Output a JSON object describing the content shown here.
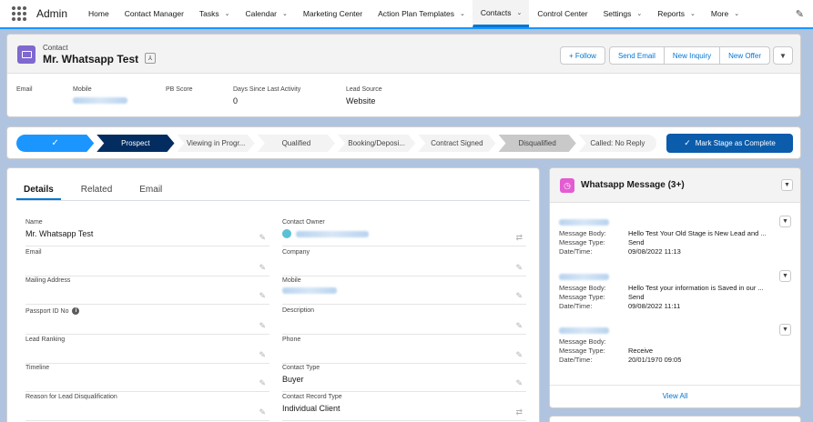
{
  "app": {
    "name": "Admin"
  },
  "nav": {
    "items": [
      {
        "label": "Home",
        "chevron": false
      },
      {
        "label": "Contact Manager",
        "chevron": false
      },
      {
        "label": "Tasks",
        "chevron": true
      },
      {
        "label": "Calendar",
        "chevron": true
      },
      {
        "label": "Marketing Center",
        "chevron": false
      },
      {
        "label": "Action Plan Templates",
        "chevron": true
      },
      {
        "label": "Contacts",
        "chevron": true,
        "active": true
      },
      {
        "label": "Control Center",
        "chevron": false
      },
      {
        "label": "Settings",
        "chevron": true
      },
      {
        "label": "Reports",
        "chevron": true
      },
      {
        "label": "More",
        "chevron": true
      }
    ]
  },
  "record": {
    "object_label": "Contact",
    "name": "Mr. Whatsapp Test",
    "actions": {
      "follow": "+ Follow",
      "send_email": "Send Email",
      "new_inquiry": "New Inquiry",
      "new_offer": "New Offer"
    },
    "highlights": {
      "email_label": "Email",
      "mobile_label": "Mobile",
      "pb_score_label": "PB Score",
      "days_label": "Days Since Last Activity",
      "days_value": "0",
      "lead_source_label": "Lead Source",
      "lead_source_value": "Website"
    }
  },
  "path": {
    "steps": [
      {
        "label": "✓",
        "state": "complete"
      },
      {
        "label": "Prospect",
        "state": "current"
      },
      {
        "label": "Viewing in Progr...",
        "state": "incomplete"
      },
      {
        "label": "Qualified",
        "state": "incomplete"
      },
      {
        "label": "Booking/Deposi...",
        "state": "incomplete"
      },
      {
        "label": "Contract Signed",
        "state": "incomplete"
      },
      {
        "label": "Disqualified",
        "state": "lost"
      },
      {
        "label": "Called: No Reply",
        "state": "incomplete"
      }
    ],
    "mark_complete": "Mark Stage as Complete"
  },
  "details": {
    "tabs": [
      "Details",
      "Related",
      "Email"
    ],
    "left": [
      {
        "label": "Name",
        "value": "Mr. Whatsapp Test"
      },
      {
        "label": "Email",
        "value": ""
      },
      {
        "label": "Mailing Address",
        "value": ""
      },
      {
        "label": "Passport ID No",
        "value": ""
      },
      {
        "label": "Lead Ranking",
        "value": ""
      },
      {
        "label": "Timeline",
        "value": ""
      },
      {
        "label": "Reason for Lead Disqualification",
        "value": ""
      }
    ],
    "right": [
      {
        "label": "Contact Owner",
        "value": ""
      },
      {
        "label": "Company",
        "value": ""
      },
      {
        "label": "Mobile",
        "value": ""
      },
      {
        "label": "Description",
        "value": ""
      },
      {
        "label": "Phone",
        "value": ""
      },
      {
        "label": "Contact Type",
        "value": "Buyer"
      },
      {
        "label": "Contact Record Type",
        "value": "Individual Client"
      }
    ]
  },
  "whatsapp": {
    "title": "Whatsapp Message (3+)",
    "labels": {
      "body": "Message Body:",
      "type": "Message Type:",
      "datetime": "Date/Time:"
    },
    "messages": [
      {
        "body": "Hello Test Your Old Stage is New Lead and ...",
        "type": "Send",
        "datetime": "09/08/2022 11:13"
      },
      {
        "body": "Hello Test your information is Saved in our ...",
        "type": "Send",
        "datetime": "09/08/2022 11:11"
      },
      {
        "body": "",
        "type": "Receive",
        "datetime": "20/01/1970 09:05"
      }
    ],
    "view_all": "View All"
  },
  "colors": {
    "brand": "#0176d3",
    "path_current": "#032d60",
    "path_complete": "#1b96ff",
    "contact_icon": "#7f68d0",
    "whatsapp_icon": "#e35cd2"
  }
}
